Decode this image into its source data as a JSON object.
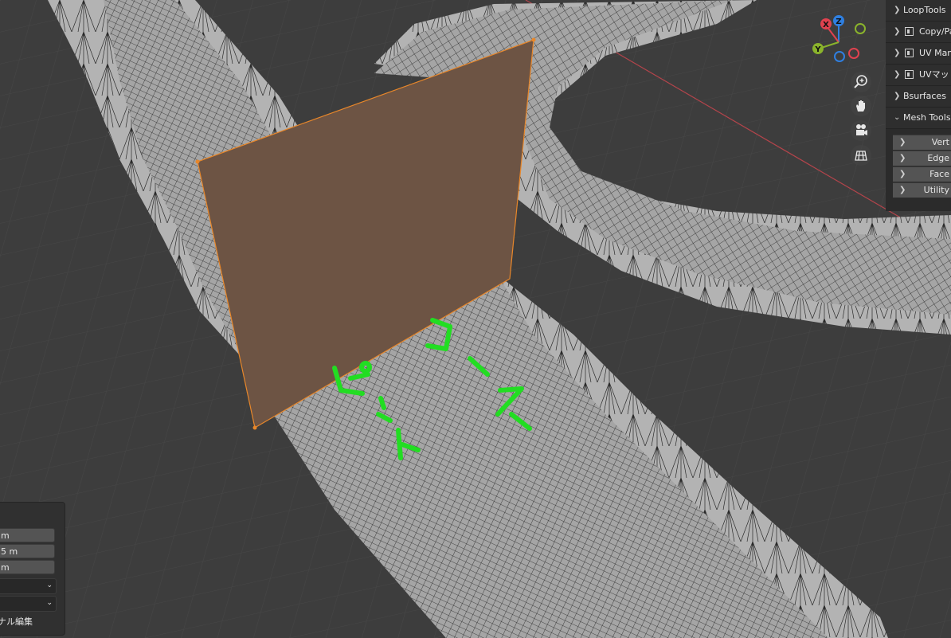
{
  "app": "Blender 3D Viewport",
  "sidebar": {
    "panels": [
      {
        "label": "LoopTools",
        "has_icon": false,
        "expanded": false
      },
      {
        "label": "Copy/Pa",
        "has_icon": true,
        "expanded": false
      },
      {
        "label": "UV Man",
        "has_icon": true,
        "expanded": false
      },
      {
        "label": "UVマッ",
        "has_icon": true,
        "expanded": false
      },
      {
        "label": "Bsurfaces",
        "has_icon": false,
        "expanded": false
      },
      {
        "label": "Mesh Tools",
        "has_icon": false,
        "expanded": true
      }
    ],
    "mesh_tools_sub": [
      "Vert",
      "Edge",
      "Face",
      "Utility"
    ]
  },
  "gizmo": {
    "z_label": "Z",
    "y_label": "Y",
    "x_label": "X",
    "colors": {
      "x": "#e0424f",
      "y": "#8ab32c",
      "z": "#2f7fe0"
    }
  },
  "nav_buttons": [
    "zoom-icon",
    "hand-pan-icon",
    "camera-icon",
    "grid-view-icon"
  ],
  "operator_panel": {
    "fields": [
      "m",
      "5 m",
      "m"
    ],
    "dropdowns": [
      "",
      ""
    ],
    "label": "ナル編集"
  },
  "annotation": {
    "color": "#22dd22",
    "words": [
      "ピット",
      "コース"
    ]
  },
  "colors": {
    "viewport_bg": "#3d3d3d",
    "mesh_face": "#a3a3a3",
    "plane": "#6d5444",
    "selection": "#e8872a"
  }
}
